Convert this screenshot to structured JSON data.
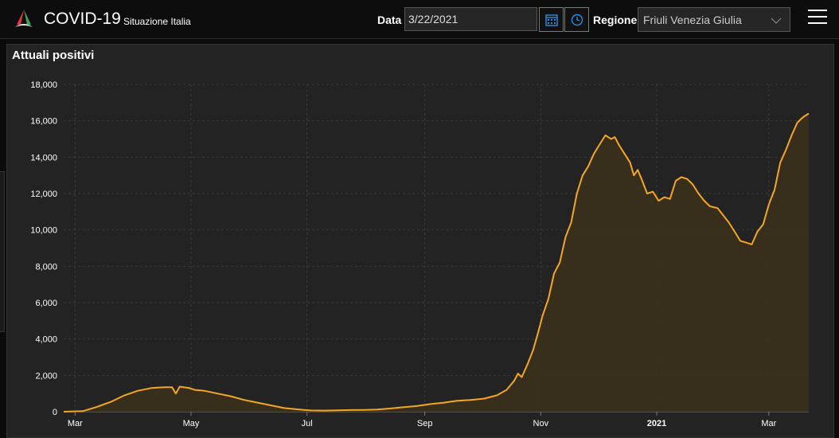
{
  "header": {
    "title": "COVID-19",
    "subtitle": "Situazione Italia",
    "date_label": "Data",
    "date_value": "3/22/2021",
    "region_label": "Regione",
    "region_value": "Friuli Venezia Giulia",
    "icons": [
      "logo-icon",
      "calendar-icon",
      "clock-icon",
      "chevron-down-icon",
      "menu-icon"
    ]
  },
  "panel": {
    "title": "Attuali positivi"
  },
  "colors": {
    "line": "#f5a623",
    "area": "#3a2f1c",
    "grid": "#3c3c3c",
    "background": "#232323"
  },
  "chart_data": {
    "type": "area",
    "title": "Attuali positivi",
    "xlabel": "",
    "ylabel": "",
    "ylim": [
      0,
      18000
    ],
    "yticks": [
      "0",
      "2,000",
      "4,000",
      "6,000",
      "8,000",
      "10,000",
      "12,000",
      "14,000",
      "16,000",
      "18,000"
    ],
    "xticks": [
      {
        "date": "2020-03-01",
        "label": "Mar",
        "bold": false
      },
      {
        "date": "2020-05-01",
        "label": "May",
        "bold": false
      },
      {
        "date": "2020-07-01",
        "label": "Jul",
        "bold": false
      },
      {
        "date": "2020-09-01",
        "label": "Sep",
        "bold": false
      },
      {
        "date": "2020-11-01",
        "label": "Nov",
        "bold": false
      },
      {
        "date": "2021-01-01",
        "label": "2021",
        "bold": true
      },
      {
        "date": "2021-03-01",
        "label": "Mar",
        "bold": false
      }
    ],
    "x_range": [
      "2020-02-24",
      "2021-03-22"
    ],
    "grid": true,
    "series": [
      {
        "points": [
          [
            "2020-02-24",
            0
          ],
          [
            "2020-03-05",
            30
          ],
          [
            "2020-03-12",
            250
          ],
          [
            "2020-03-20",
            550
          ],
          [
            "2020-03-27",
            900
          ],
          [
            "2020-04-03",
            1150
          ],
          [
            "2020-04-10",
            1300
          ],
          [
            "2020-04-17",
            1350
          ],
          [
            "2020-04-21",
            1350
          ],
          [
            "2020-04-23",
            1000
          ],
          [
            "2020-04-25",
            1380
          ],
          [
            "2020-04-30",
            1300
          ],
          [
            "2020-05-03",
            1200
          ],
          [
            "2020-05-08",
            1150
          ],
          [
            "2020-05-15",
            1000
          ],
          [
            "2020-05-22",
            850
          ],
          [
            "2020-05-29",
            650
          ],
          [
            "2020-06-05",
            500
          ],
          [
            "2020-06-12",
            350
          ],
          [
            "2020-06-19",
            200
          ],
          [
            "2020-06-26",
            130
          ],
          [
            "2020-07-03",
            70
          ],
          [
            "2020-07-10",
            60
          ],
          [
            "2020-07-17",
            80
          ],
          [
            "2020-07-24",
            90
          ],
          [
            "2020-07-31",
            100
          ],
          [
            "2020-08-07",
            120
          ],
          [
            "2020-08-14",
            180
          ],
          [
            "2020-08-21",
            250
          ],
          [
            "2020-08-28",
            320
          ],
          [
            "2020-09-04",
            420
          ],
          [
            "2020-09-11",
            500
          ],
          [
            "2020-09-18",
            600
          ],
          [
            "2020-09-25",
            650
          ],
          [
            "2020-10-02",
            720
          ],
          [
            "2020-10-09",
            900
          ],
          [
            "2020-10-14",
            1200
          ],
          [
            "2020-10-18",
            1700
          ],
          [
            "2020-10-20",
            2100
          ],
          [
            "2020-10-22",
            1900
          ],
          [
            "2020-10-25",
            2600
          ],
          [
            "2020-10-28",
            3400
          ],
          [
            "2020-10-31",
            4500
          ],
          [
            "2020-11-02",
            5300
          ],
          [
            "2020-11-05",
            6200
          ],
          [
            "2020-11-08",
            7600
          ],
          [
            "2020-11-11",
            8200
          ],
          [
            "2020-11-14",
            9600
          ],
          [
            "2020-11-17",
            10400
          ],
          [
            "2020-11-20",
            12000
          ],
          [
            "2020-11-23",
            13000
          ],
          [
            "2020-11-26",
            13500
          ],
          [
            "2020-11-29",
            14200
          ],
          [
            "2020-12-02",
            14700
          ],
          [
            "2020-12-05",
            15200
          ],
          [
            "2020-12-08",
            15000
          ],
          [
            "2020-12-10",
            15100
          ],
          [
            "2020-12-12",
            14700
          ],
          [
            "2020-12-15",
            14200
          ],
          [
            "2020-12-18",
            13700
          ],
          [
            "2020-12-20",
            13000
          ],
          [
            "2020-12-22",
            13300
          ],
          [
            "2020-12-24",
            12800
          ],
          [
            "2020-12-27",
            12000
          ],
          [
            "2020-12-30",
            12100
          ],
          [
            "2021-01-02",
            11600
          ],
          [
            "2021-01-05",
            11800
          ],
          [
            "2021-01-08",
            11700
          ],
          [
            "2021-01-11",
            12700
          ],
          [
            "2021-01-14",
            12900
          ],
          [
            "2021-01-17",
            12800
          ],
          [
            "2021-01-20",
            12500
          ],
          [
            "2021-01-23",
            12000
          ],
          [
            "2021-01-26",
            11600
          ],
          [
            "2021-01-29",
            11300
          ],
          [
            "2021-02-02",
            11200
          ],
          [
            "2021-02-05",
            10800
          ],
          [
            "2021-02-08",
            10400
          ],
          [
            "2021-02-11",
            9900
          ],
          [
            "2021-02-14",
            9400
          ],
          [
            "2021-02-17",
            9300
          ],
          [
            "2021-02-20",
            9200
          ],
          [
            "2021-02-23",
            9900
          ],
          [
            "2021-02-26",
            10300
          ],
          [
            "2021-03-01",
            11400
          ],
          [
            "2021-03-04",
            12200
          ],
          [
            "2021-03-07",
            13700
          ],
          [
            "2021-03-10",
            14400
          ],
          [
            "2021-03-13",
            15200
          ],
          [
            "2021-03-16",
            15900
          ],
          [
            "2021-03-19",
            16200
          ],
          [
            "2021-03-22",
            16400
          ]
        ]
      }
    ]
  }
}
